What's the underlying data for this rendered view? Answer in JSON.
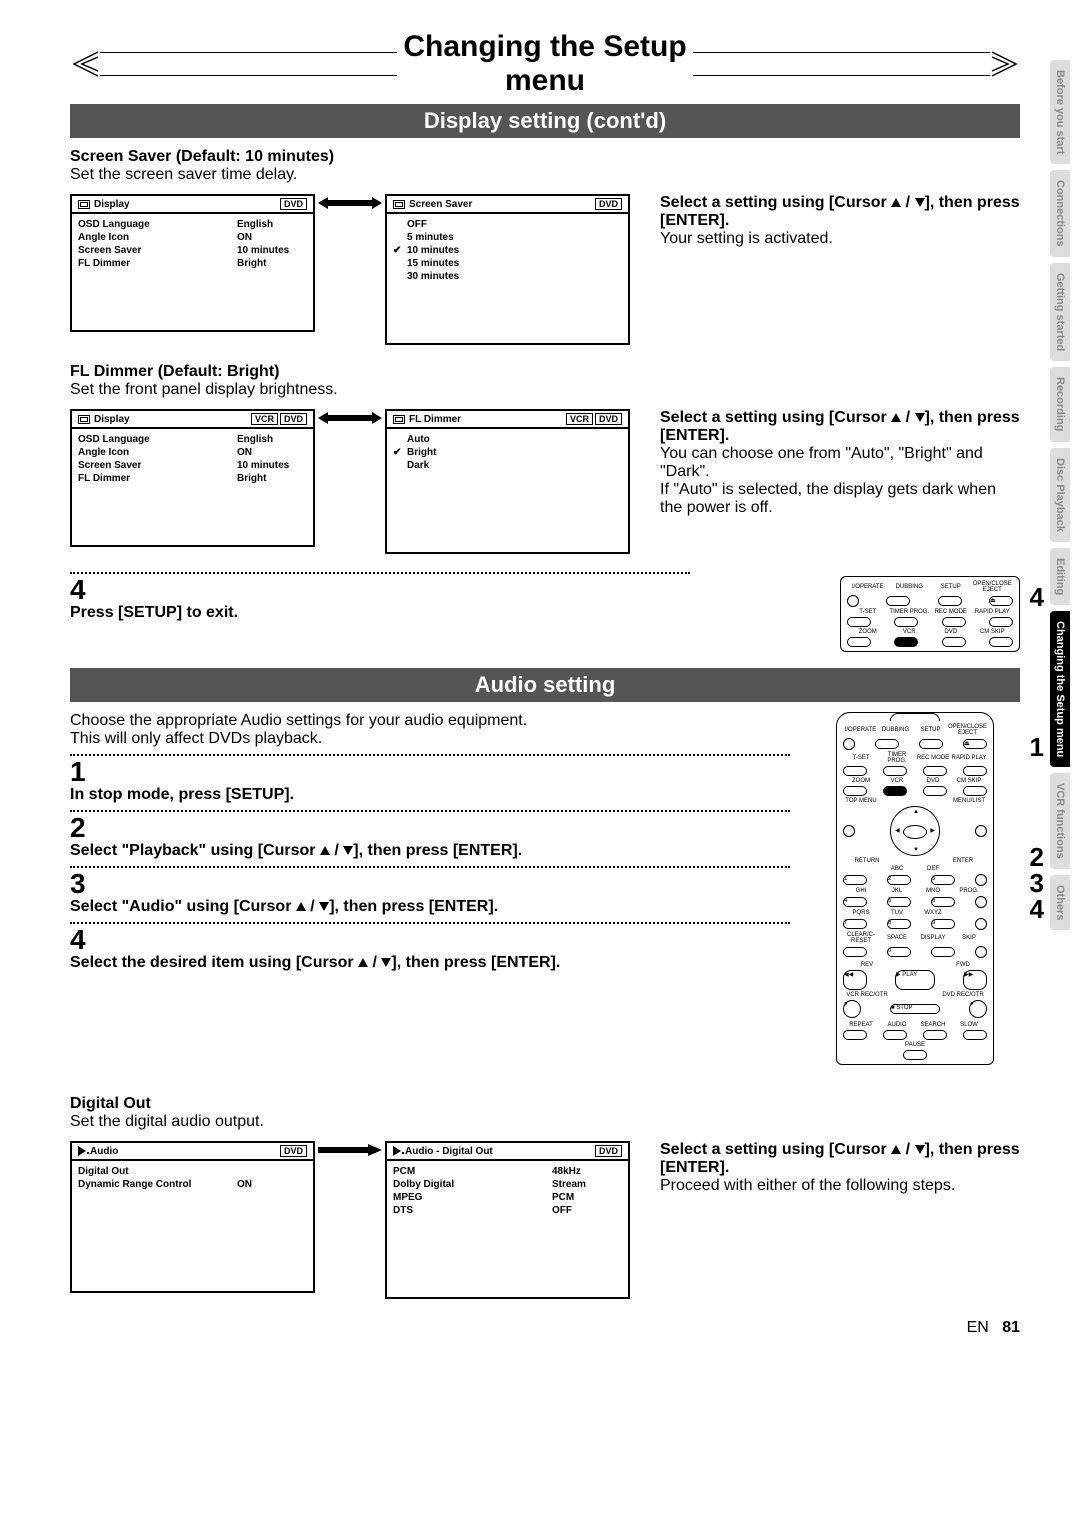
{
  "page_title": "Changing the Setup menu",
  "banner1": "Display setting (cont'd)",
  "banner2": "Audio setting",
  "side_tabs": [
    "Before you start",
    "Connections",
    "Getting started",
    "Recording",
    "Disc Playback",
    "Editing",
    "Changing the Setup menu",
    "VCR functions",
    "Others"
  ],
  "active_tab": 6,
  "screen_saver": {
    "heading": "Screen Saver (Default: 10 minutes)",
    "desc": "Set the screen saver time delay.",
    "left_box": {
      "title": "Display",
      "tags": [
        "DVD"
      ],
      "rows": [
        {
          "k": "OSD Language",
          "v": "English"
        },
        {
          "k": "Angle Icon",
          "v": "ON"
        },
        {
          "k": "Screen Saver",
          "v": "10 minutes"
        },
        {
          "k": "FL Dimmer",
          "v": "Bright"
        }
      ]
    },
    "right_box": {
      "title": "Screen Saver",
      "tags": [
        "DVD"
      ],
      "options": [
        "OFF",
        "5 minutes",
        "10 minutes",
        "15 minutes",
        "30 minutes"
      ],
      "checked": 2
    },
    "instr_h": "Select a setting using [Cursor ▲ / ▼], then press [ENTER].",
    "instr_p": "Your setting is activated."
  },
  "fl_dimmer": {
    "heading": "FL Dimmer (Default: Bright)",
    "desc": "Set the front panel display brightness.",
    "left_box": {
      "title": "Display",
      "tags": [
        "VCR",
        "DVD"
      ],
      "rows": [
        {
          "k": "OSD Language",
          "v": "English"
        },
        {
          "k": "Angle Icon",
          "v": "ON"
        },
        {
          "k": "Screen Saver",
          "v": "10 minutes"
        },
        {
          "k": "FL Dimmer",
          "v": "Bright"
        }
      ]
    },
    "right_box": {
      "title": "FL Dimmer",
      "tags": [
        "VCR",
        "DVD"
      ],
      "options": [
        "Auto",
        "Bright",
        "Dark"
      ],
      "checked": 1
    },
    "instr_h": "Select a setting using [Cursor ▲ / ▼], then press [ENTER].",
    "instr_p": "You can choose one from \"Auto\", \"Bright\" and \"Dark\".\nIf \"Auto\" is selected, the display gets dark when the power is off."
  },
  "step4_exit": {
    "num": "4",
    "text": "Press [SETUP] to exit."
  },
  "remote_small": {
    "row1": [
      "I/OPERATE",
      "DUBBING",
      "SETUP",
      "OPEN/CLOSE EJECT"
    ],
    "row2": [
      "T-SET",
      "TIMER PROG.",
      "REC MODE",
      "RAPID PLAY"
    ],
    "row3": [
      "ZOOM",
      "VCR",
      "DVD",
      "CM SKIP"
    ]
  },
  "remote_small_callout": "4",
  "audio_intro": "Choose the appropriate Audio settings for your audio equipment.\nThis will only affect DVDs playback.",
  "steps": [
    {
      "n": "1",
      "t": "In stop mode, press [SETUP]."
    },
    {
      "n": "2",
      "t": "Select \"Playback\" using [Cursor ▲ / ▼], then press [ENTER]."
    },
    {
      "n": "3",
      "t": "Select \"Audio\" using [Cursor ▲ / ▼], then press [ENTER]."
    },
    {
      "n": "4",
      "t": "Select the desired item using [Cursor ▲ / ▼], then press [ENTER]."
    }
  ],
  "remote_full": {
    "row1": [
      "I/OPERATE",
      "DUBBING",
      "SETUP",
      "OPEN/CLOSE EJECT"
    ],
    "row2": [
      "T-SET",
      "TIMER PROG.",
      "REC MODE",
      "RAPID PLAY"
    ],
    "row3": [
      "ZOOM",
      "VCR",
      "DVD",
      "CM SKIP"
    ],
    "row4": [
      "TOP MENU",
      "",
      "",
      "MENU/LIST"
    ],
    "nav": [
      "RETURN",
      "ENTER"
    ],
    "numrow_labels": [
      [
        "",
        "ABC",
        "DEF",
        ""
      ],
      [
        "GHI",
        "JKL",
        "MNO",
        ""
      ],
      [
        "PQRS",
        "TUV",
        "WXYZ",
        ""
      ],
      [
        "CLEAR/C-RESET",
        "SPACE",
        "DISPLAY",
        "SKIP"
      ]
    ],
    "nums": [
      [
        "1",
        "2",
        "3",
        "PROG."
      ],
      [
        "4",
        "5",
        "6",
        ""
      ],
      [
        "7",
        "8",
        "9",
        ""
      ],
      [
        "",
        "0",
        "",
        ""
      ]
    ],
    "transport": [
      "REV",
      "PLAY",
      "FWD",
      "STOP"
    ],
    "rec": [
      "VCR REC/OTR",
      "DVD REC/OTR"
    ],
    "bottom": [
      "REPEAT",
      "AUDIO",
      "SEARCH",
      "SLOW"
    ],
    "pause": "PAUSE"
  },
  "remote_full_callouts": [
    "1",
    "2",
    "3",
    "4"
  ],
  "digital_out": {
    "heading": "Digital Out",
    "desc": "Set the digital audio output.",
    "left_box": {
      "title": "Audio",
      "tags": [
        "DVD"
      ],
      "rows": [
        {
          "k": "Digital Out",
          "v": ""
        },
        {
          "k": "Dynamic Range Control",
          "v": "ON"
        }
      ]
    },
    "right_box": {
      "title": "Audio - Digital Out",
      "tags": [
        "DVD"
      ],
      "rows": [
        {
          "k": "PCM",
          "v": "48kHz"
        },
        {
          "k": "Dolby Digital",
          "v": "Stream"
        },
        {
          "k": "MPEG",
          "v": "PCM"
        },
        {
          "k": "DTS",
          "v": "OFF"
        }
      ]
    },
    "instr_h": "Select a setting using [Cursor ▲ / ▼], then press [ENTER].",
    "instr_p": "Proceed with either of the following steps."
  },
  "footer": {
    "lang": "EN",
    "page": "81"
  }
}
